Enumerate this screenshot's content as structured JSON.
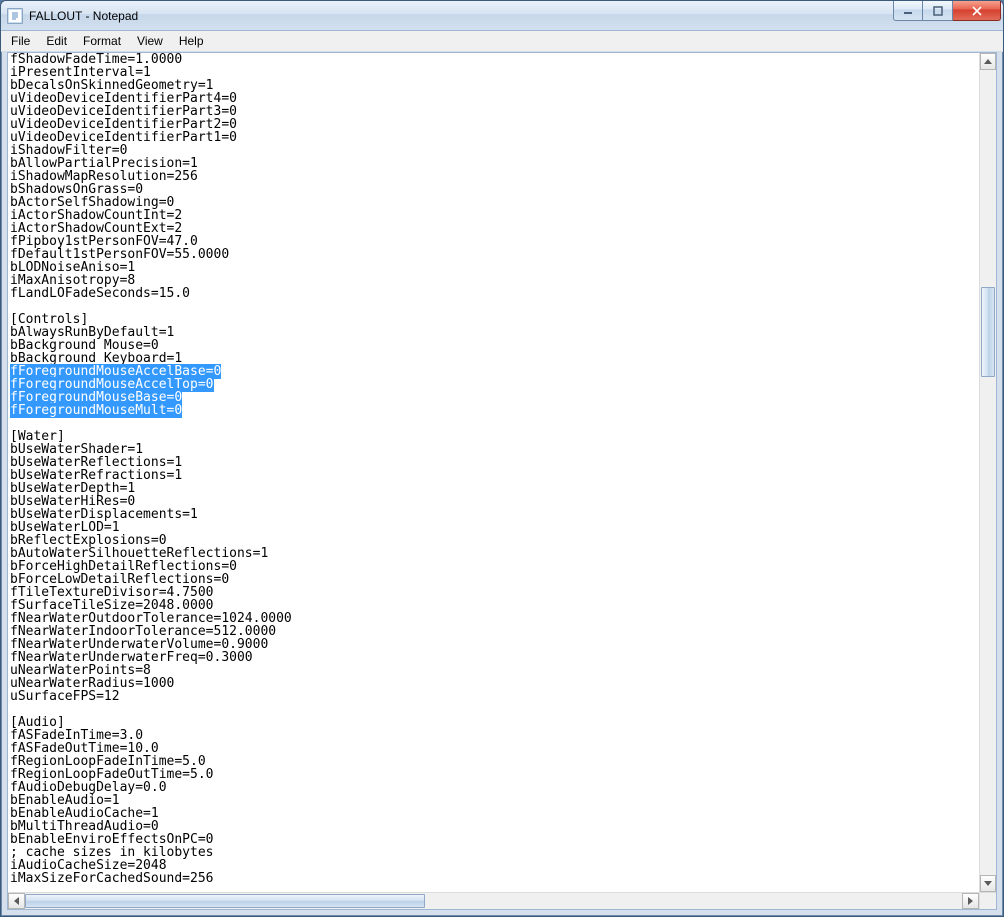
{
  "window": {
    "title": "FALLOUT - Notepad"
  },
  "menu": {
    "file": "File",
    "edit": "Edit",
    "format": "Format",
    "view": "View",
    "help": "Help"
  },
  "content": {
    "lines": [
      "fShadowFadeTime=1.0000",
      "iPresentInterval=1",
      "bDecalsOnSkinnedGeometry=1",
      "uVideoDeviceIdentifierPart4=0",
      "uVideoDeviceIdentifierPart3=0",
      "uVideoDeviceIdentifierPart2=0",
      "uVideoDeviceIdentifierPart1=0",
      "iShadowFilter=0",
      "bAllowPartialPrecision=1",
      "iShadowMapResolution=256",
      "bShadowsOnGrass=0",
      "bActorSelfShadowing=0",
      "iActorShadowCountInt=2",
      "iActorShadowCountExt=2",
      "fPipboy1stPersonFOV=47.0",
      "fDefault1stPersonFOV=55.0000",
      "bLODNoiseAniso=1",
      "iMaxAnisotropy=8",
      "fLandLOFadeSeconds=15.0",
      "",
      "[Controls]",
      "bAlwaysRunByDefault=1",
      "bBackground Mouse=0",
      "bBackground Keyboard=1",
      "fForegroundMouseAccelBase=0",
      "fForegroundMouseAccelTop=0",
      "fForegroundMouseBase=0",
      "fForegroundMouseMult=0",
      "",
      "[Water]",
      "bUseWaterShader=1",
      "bUseWaterReflections=1",
      "bUseWaterRefractions=1",
      "bUseWaterDepth=1",
      "bUseWaterHiRes=0",
      "bUseWaterDisplacements=1",
      "bUseWaterLOD=1",
      "bReflectExplosions=0",
      "bAutoWaterSilhouetteReflections=1",
      "bForceHighDetailReflections=0",
      "bForceLowDetailReflections=0",
      "fTileTextureDivisor=4.7500",
      "fSurfaceTileSize=2048.0000",
      "fNearWaterOutdoorTolerance=1024.0000",
      "fNearWaterIndoorTolerance=512.0000",
      "fNearWaterUnderwaterVolume=0.9000",
      "fNearWaterUnderwaterFreq=0.3000",
      "uNearWaterPoints=8",
      "uNearWaterRadius=1000",
      "uSurfaceFPS=12",
      "",
      "[Audio]",
      "fASFadeInTime=3.0",
      "fASFadeOutTime=10.0",
      "fRegionLoopFadeInTime=5.0",
      "fRegionLoopFadeOutTime=5.0",
      "fAudioDebugDelay=0.0",
      "bEnableAudio=1",
      "bEnableAudioCache=1",
      "bMultiThreadAudio=0",
      "bEnableEnviroEffectsOnPC=0",
      "; cache sizes in kilobytes",
      "iAudioCacheSize=2048",
      "iMaxSizeForCachedSound=256"
    ],
    "selected_line_indices": [
      24,
      25,
      26,
      27
    ]
  }
}
